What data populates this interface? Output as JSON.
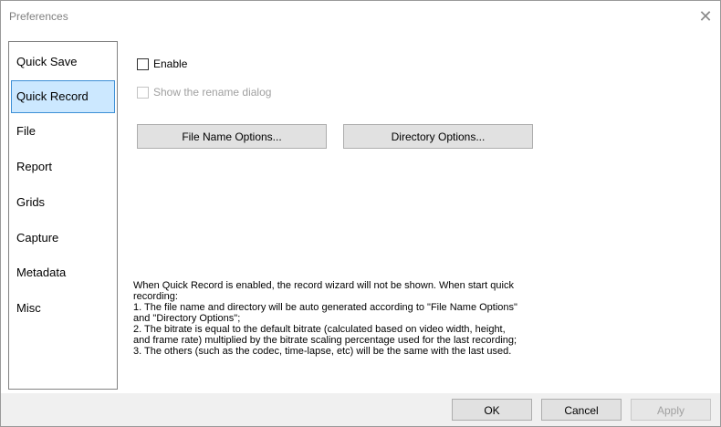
{
  "window": {
    "title": "Preferences",
    "close_glyph": "✕"
  },
  "sidebar": {
    "items": [
      {
        "label": "Quick Save",
        "active": false
      },
      {
        "label": "Quick Record",
        "active": true
      },
      {
        "label": "File",
        "active": false
      },
      {
        "label": "Report",
        "active": false
      },
      {
        "label": "Grids",
        "active": false
      },
      {
        "label": "Capture",
        "active": false
      },
      {
        "label": "Metadata",
        "active": false
      },
      {
        "label": "Misc",
        "active": false
      }
    ]
  },
  "content": {
    "enable": {
      "label": "Enable",
      "checked": false
    },
    "rename_dialog": {
      "label": "Show the rename dialog",
      "checked": false,
      "disabled": true
    },
    "file_name_options_label": "File Name Options...",
    "directory_options_label": "Directory Options...",
    "info_lines": [
      "When Quick Record is enabled, the record wizard will not be shown. When start quick",
      "recording:",
      "1. The file name and directory will be auto generated according to \"File Name Options\"",
      "and \"Directory Options\";",
      "2. The bitrate is equal to the default bitrate (calculated based on video width, height,",
      "and frame rate) multiplied by the bitrate scaling percentage used for the last recording;",
      "3. The others (such as the codec, time-lapse, etc) will be the same with the last used."
    ]
  },
  "footer": {
    "ok_label": "OK",
    "cancel_label": "Cancel",
    "apply_label": "Apply",
    "apply_disabled": true
  }
}
